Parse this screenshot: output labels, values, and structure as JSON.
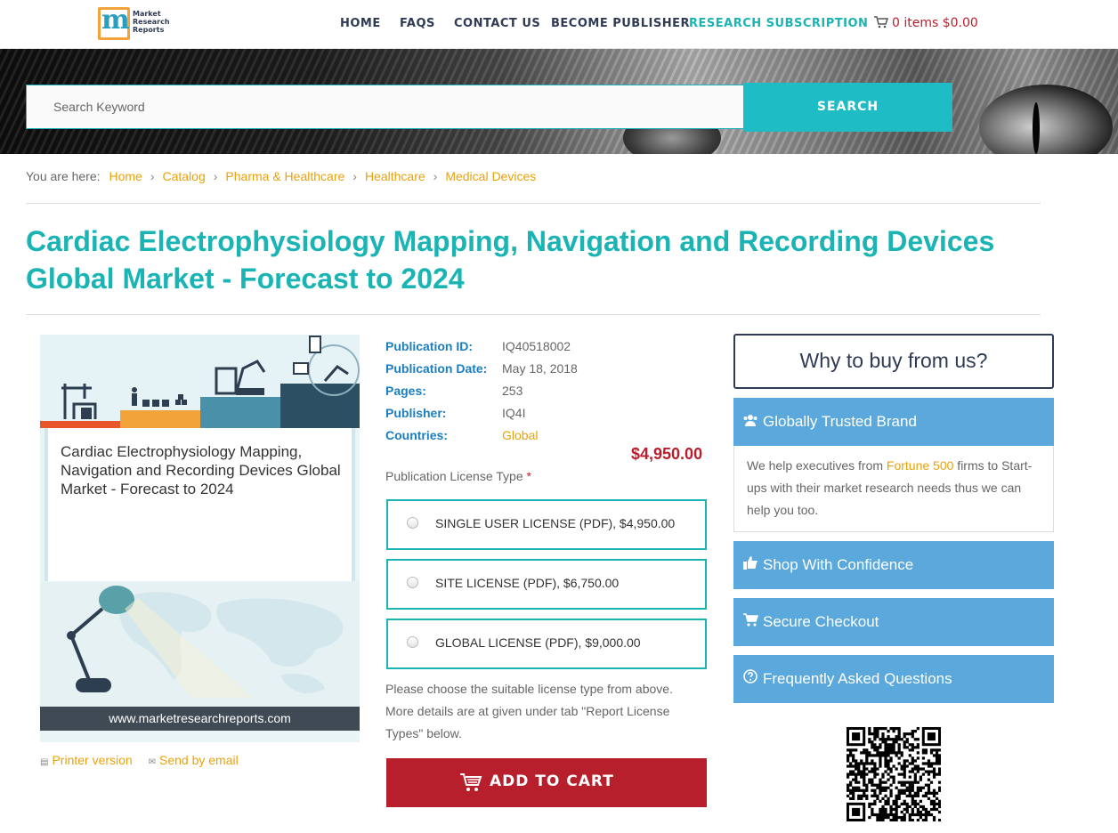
{
  "header": {
    "logo_lines": [
      "Market",
      "Research",
      "Reports"
    ],
    "nav": [
      "HOME",
      "FAQS",
      "CONTACT US",
      "BECOME PUBLISHER",
      "RESEARCH SUBSCRIPTION"
    ],
    "cart_text": "0 items $0.00"
  },
  "search": {
    "placeholder": "Search Keyword",
    "button": "SEARCH"
  },
  "breadcrumb": {
    "prefix": "You are here:",
    "items": [
      "Home",
      "Catalog",
      "Pharma & Healthcare",
      "Healthcare",
      "Medical Devices"
    ]
  },
  "report": {
    "title": "Cardiac Electrophysiology Mapping, Navigation and Recording Devices Global Market - Forecast to 2024",
    "cover_title": "Cardiac Electrophysiology Mapping, Navigation and Recording Devices Global Market - Forecast to 2024",
    "cover_url": "www.marketresearchreports.com",
    "printer_link": "Printer version",
    "email_link": "Send by email",
    "details": [
      {
        "label": "Publication ID:",
        "value": "IQ40518002"
      },
      {
        "label": "Publication Date:",
        "value": "May 18, 2018"
      },
      {
        "label": "Pages:",
        "value": "253"
      },
      {
        "label": "Publisher:",
        "value": "IQ4I"
      },
      {
        "label": "Countries:",
        "value": "Global"
      }
    ],
    "price": "$4,950.00",
    "license_label": "Publication License Type",
    "required_mark": "*",
    "licenses": [
      "SINGLE USER LICENSE (PDF), $4,950.00",
      "SITE LICENSE (PDF), $6,750.00",
      "GLOBAL LICENSE (PDF), $9,000.00"
    ],
    "note": "Please choose the suitable license type from above. More details are at given under tab \"Report License Types\" below.",
    "add_to_cart": "ADD TO CART"
  },
  "sidebar": {
    "why_title": "Why to buy from us?",
    "panels": [
      {
        "title": "Globally Trusted Brand",
        "icon": "users-icon"
      },
      {
        "title": "Shop With Confidence",
        "icon": "thumbs-up-icon"
      },
      {
        "title": "Secure Checkout",
        "icon": "cart-icon"
      },
      {
        "title": "Frequently Asked Questions",
        "icon": "question-circle-icon"
      }
    ],
    "trusted_body": {
      "before": "We help executives from ",
      "highlight": "Fortune 500",
      "after": " firms to Start-ups with their market research needs thus we can help you too."
    }
  },
  "colors": {
    "teal": "#1ab4b4",
    "navy": "#2f3b55",
    "red": "#b81f2d",
    "orange": "#e8a20c",
    "panel_blue": "#5aa8dc"
  }
}
